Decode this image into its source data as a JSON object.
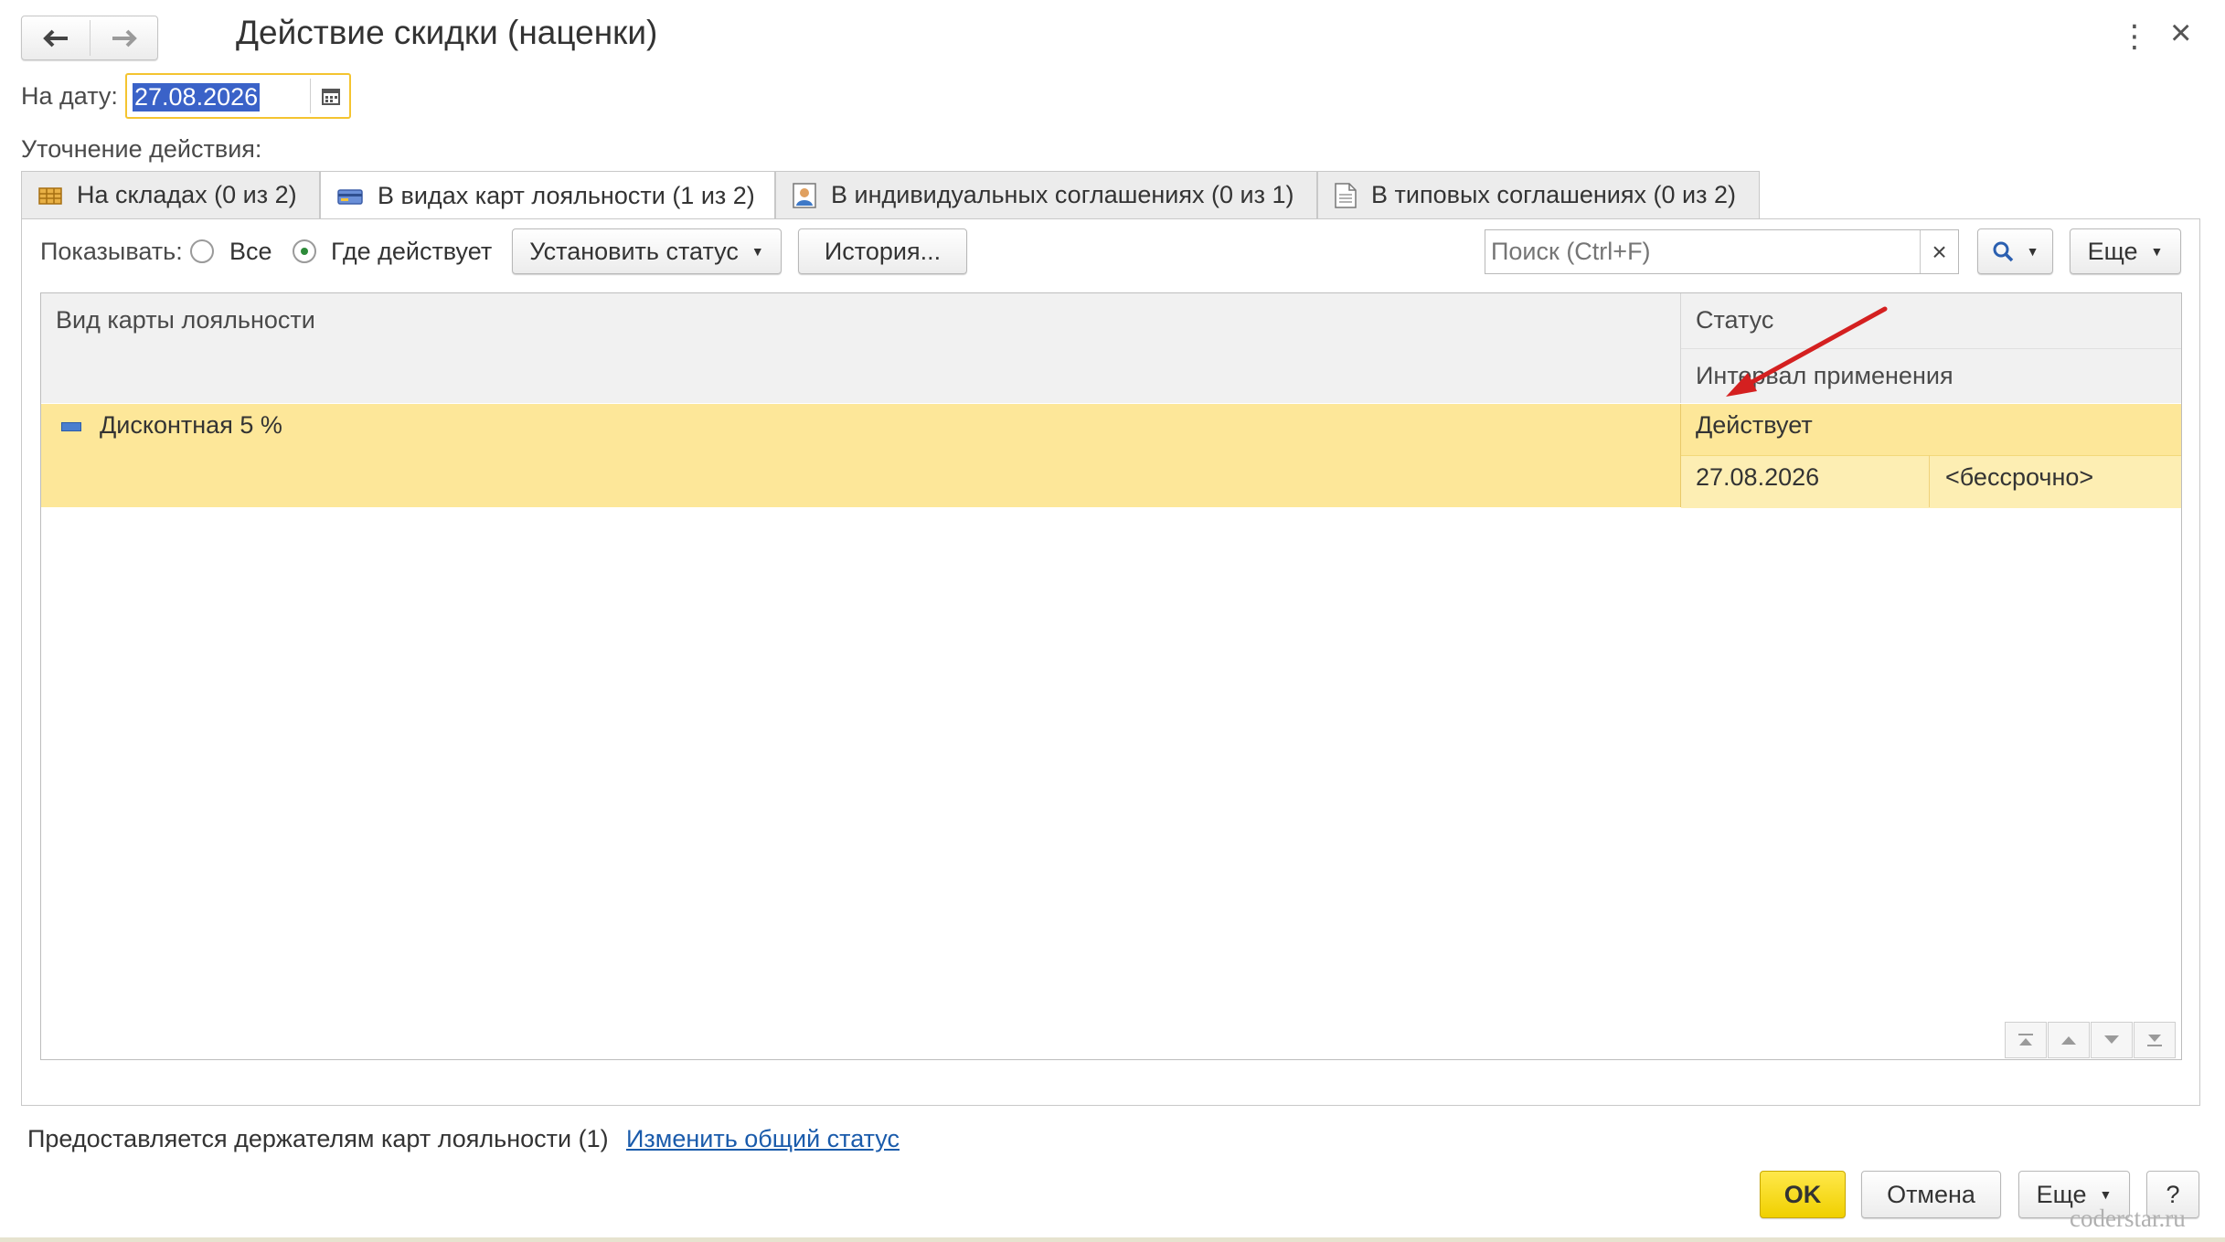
{
  "window": {
    "title": "Действие скидки (наценки)",
    "back_icon": "arrow-left",
    "forward_icon": "arrow-right",
    "menu_icon": "⋮",
    "close_icon": "×"
  },
  "date": {
    "label": "На дату:",
    "value": "27.08.2026"
  },
  "clarify_label": "Уточнение действия:",
  "tabs": [
    {
      "label": "На складах (0 из 2)",
      "icon": "warehouse-icon"
    },
    {
      "label": "В видах карт лояльности (1 из 2)",
      "icon": "loyalty-card-icon",
      "active": true
    },
    {
      "label": "В индивидуальных соглашениях (0 из 1)",
      "icon": "person-document-icon"
    },
    {
      "label": "В типовых соглашениях (0 из 2)",
      "icon": "document-icon"
    }
  ],
  "toolbar": {
    "show_label": "Показывать:",
    "radio_all": "Все",
    "radio_active": "Где действует",
    "selected": "Где действует",
    "set_status": "Установить статус",
    "history": "История...",
    "search_placeholder": "Поиск (Ctrl+F)",
    "clear": "×",
    "more": "Еще"
  },
  "table": {
    "col_name": "Вид карты лояльности",
    "col_status": "Статус",
    "col_interval": "Интервал применения",
    "rows": [
      {
        "name": "Дисконтная 5 %",
        "status": "Действует",
        "from": "27.08.2026",
        "to": "<бессрочно>"
      }
    ]
  },
  "footer": {
    "info": "Предоставляется держателям карт лояльности (1)",
    "change_link": "Изменить общий статус",
    "ok": "OK",
    "cancel": "Отмена",
    "more": "Еще",
    "help": "?",
    "watermark": "coderstar.ru"
  },
  "colors": {
    "accent_yellow": "#fde799",
    "ok_button": "#f5d800",
    "arrow_annotation": "#d42020"
  }
}
